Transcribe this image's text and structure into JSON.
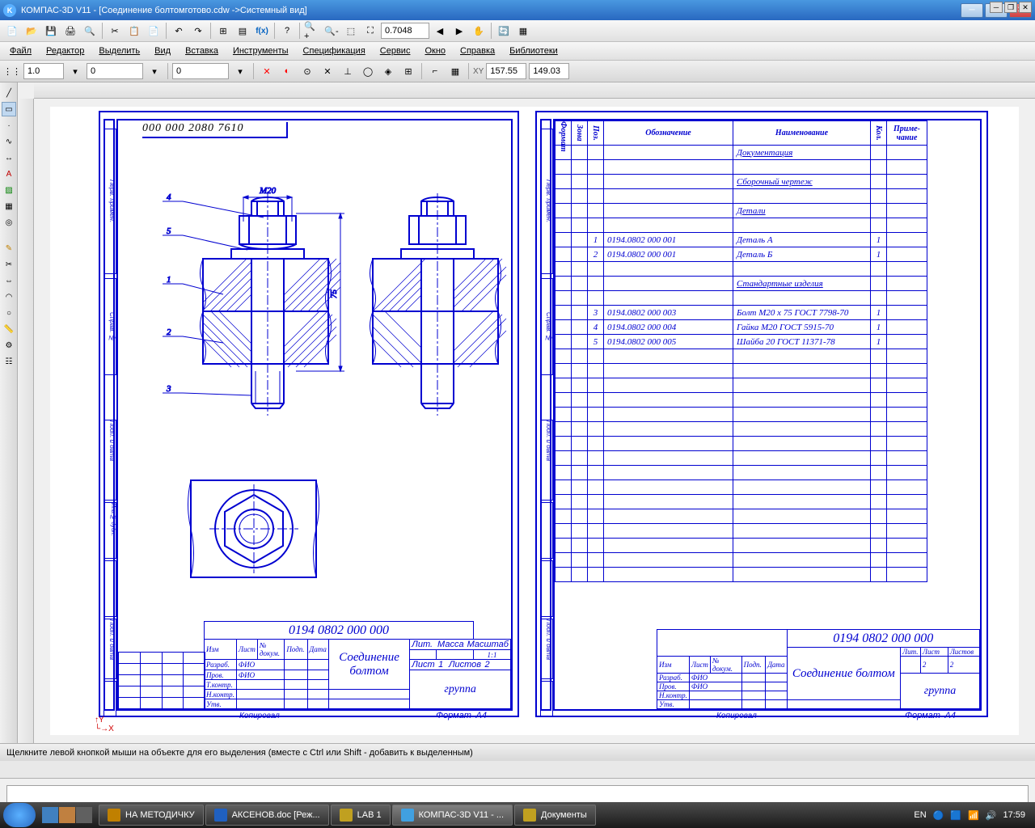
{
  "app": {
    "title": "КОМПАС-3D V11 - [Соединение болтомготово.cdw ->Системный вид]",
    "icon": "K"
  },
  "menu": [
    "Файл",
    "Редактор",
    "Выделить",
    "Вид",
    "Вставка",
    "Инструменты",
    "Спецификация",
    "Сервис",
    "Окно",
    "Справка",
    "Библиотеки"
  ],
  "zoom": "0.7048",
  "prop": {
    "scale": "1.0",
    "val1": "0",
    "val2": "0",
    "x": "157.55",
    "y": "149.03"
  },
  "status": "Щелкните левой кнопкой мыши на объекте для его выделения (вместе с Ctrl или Shift - добавить к выделенным)",
  "taskbar": {
    "items": [
      "НА МЕТОДИЧКУ",
      "АКСЕНОВ.doc [Реж...",
      "LAB 1",
      "КОМПАС-3D V11 - ...",
      "Документы"
    ],
    "lang": "EN",
    "time": "17:59"
  },
  "drawing": {
    "number": "0194 0802 000 000",
    "number_rot": "000 000 2080 7610",
    "title": "Соединение болтом",
    "dim_m": "М20",
    "dim_h": "75",
    "scale": "1:1",
    "sheet": "1",
    "sheets": "2",
    "group": "группа",
    "format": "А4",
    "copied": "Копировал",
    "callouts": [
      "1",
      "2",
      "3",
      "4",
      "5"
    ],
    "tb": {
      "izm": "Изм",
      "list": "Лист",
      "ndok": "№ докум.",
      "podp": "Подп.",
      "data": "Дата",
      "razrab": "Разраб.",
      "prov": "Пров.",
      "tkontr": "Т.контр.",
      "nkontr": "Н.контр.",
      "utv": "Утв.",
      "fio": "ФИО",
      "lit": "Лит.",
      "massa": "Масса",
      "mashtab": "Масштаб",
      "listov": "Листов"
    }
  },
  "spec": {
    "headers": {
      "format": "Формат",
      "zone": "Зона",
      "poz": "Поз.",
      "oboz": "Обозначение",
      "naim": "Наименование",
      "kol": "Кол.",
      "prim": "Приме-чание"
    },
    "rows": [
      {
        "poz": "",
        "oboz": "",
        "naim": "Документация",
        "kol": ""
      },
      {
        "poz": "",
        "oboz": "",
        "naim": "",
        "kol": ""
      },
      {
        "poz": "",
        "oboz": "",
        "naim": "Сборочный чертеж",
        "kol": ""
      },
      {
        "poz": "",
        "oboz": "",
        "naim": "",
        "kol": ""
      },
      {
        "poz": "",
        "oboz": "",
        "naim": "Детали",
        "kol": ""
      },
      {
        "poz": "",
        "oboz": "",
        "naim": "",
        "kol": ""
      },
      {
        "poz": "1",
        "oboz": "0194.0802 000 001",
        "naim": "Деталь А",
        "kol": "1"
      },
      {
        "poz": "2",
        "oboz": "0194.0802 000 001",
        "naim": "Деталь Б",
        "kol": "1"
      },
      {
        "poz": "",
        "oboz": "",
        "naim": "",
        "kol": ""
      },
      {
        "poz": "",
        "oboz": "",
        "naim": "Стандартные изделия",
        "kol": ""
      },
      {
        "poz": "",
        "oboz": "",
        "naim": "",
        "kol": ""
      },
      {
        "poz": "3",
        "oboz": "0194.0802 000 003",
        "naim": "Болт М20 х 75 ГОСТ 7798-70",
        "kol": "1"
      },
      {
        "poz": "4",
        "oboz": "0194.0802 000 004",
        "naim": "Гайка М20 ГОСТ 5915-70",
        "kol": "1"
      },
      {
        "poz": "5",
        "oboz": "0194.0802 000 005",
        "naim": "Шайба 20 ГОСТ 11371-78",
        "kol": "1"
      }
    ],
    "sheet": "2",
    "sheets": "2"
  }
}
